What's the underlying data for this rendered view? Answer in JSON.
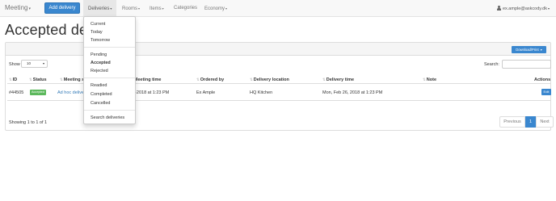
{
  "navbar": {
    "brand": "Meeting",
    "add_button": "Add delivery",
    "items": [
      {
        "label": "Deliveries",
        "active": true
      },
      {
        "label": "Rooms"
      },
      {
        "label": "Items"
      },
      {
        "label": "Categories"
      },
      {
        "label": "Economy"
      }
    ],
    "user": "ex.ample@askcody.dk",
    "icons": {
      "user": "person-icon",
      "dropdown": "caret-down-icon"
    }
  },
  "page": {
    "title": "Accepted delive"
  },
  "panel": {
    "download_button": "Download/Print",
    "show_label": "Show",
    "page_size": "10",
    "search_label": "Search:",
    "search_value": ""
  },
  "table": {
    "columns": [
      "ID",
      "Status",
      "Meeting su",
      "Meeting time",
      "Ordered by",
      "Delivery location",
      "Delivery time",
      "Note",
      "Actions"
    ],
    "rows": [
      {
        "id": "#44505",
        "status": "Accepted",
        "meeting_subject": "Ad hoc delive",
        "meeting_time": "6-2018 at 1:23 PM",
        "ordered_by": "Ex Ample",
        "delivery_location": "HQ Kitchen",
        "delivery_time": "Mon, Feb 26, 2018 at 1:23 PM",
        "note": "",
        "action": "Edit"
      }
    ],
    "status_color": "#5cb85c"
  },
  "footer": {
    "showing": "Showing 1 to 1 of 1",
    "pagination": {
      "previous": "Previous",
      "current": "1",
      "next": "Next"
    }
  },
  "dropdown": {
    "groups": [
      [
        "Current",
        "Today",
        "Tomorrow"
      ],
      [
        "Pending",
        "Accepted",
        "Rejected"
      ],
      [
        "Readied",
        "Completed",
        "Cancelled"
      ],
      [
        "Search deliveries"
      ]
    ],
    "selected": "Accepted"
  },
  "colors": {
    "primary": "#3a87cf",
    "success": "#5cb85c",
    "navbar_bg": "#f8f8f8",
    "link": "#337ab7"
  }
}
